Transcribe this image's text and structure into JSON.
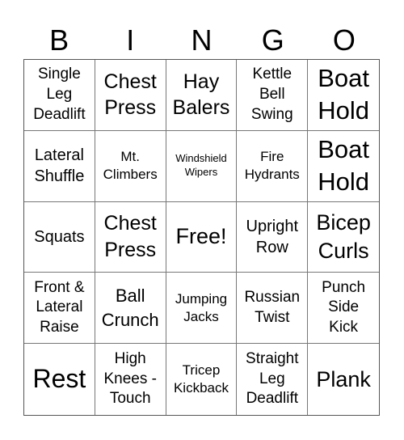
{
  "header": {
    "letters": [
      "B",
      "I",
      "N",
      "G",
      "O"
    ]
  },
  "cells": [
    [
      "Single",
      "Leg",
      "Deadlift"
    ],
    [
      "Chest",
      "Press"
    ],
    [
      "Hay",
      "Balers"
    ],
    [
      "Kettle",
      "Bell",
      "Swing"
    ],
    [
      "Boat",
      "Hold"
    ],
    [
      "Lateral",
      "Shuffle"
    ],
    [
      "Mt.",
      "Climbers"
    ],
    [
      "Windshield",
      "Wipers"
    ],
    [
      "Fire",
      "Hydrants"
    ],
    [
      "Boat",
      "Hold"
    ],
    [
      "Squats"
    ],
    [
      "Chest",
      "Press"
    ],
    [
      "Free!"
    ],
    [
      "Upright",
      "Row"
    ],
    [
      "Bicep",
      "Curls"
    ],
    [
      "Front &",
      "Lateral",
      "Raise"
    ],
    [
      "Ball",
      "Crunch"
    ],
    [
      "Jumping",
      "Jacks"
    ],
    [
      "Russian",
      "Twist"
    ],
    [
      "Punch",
      "Side",
      "Kick"
    ],
    [
      "Rest"
    ],
    [
      "High",
      "Knees -",
      "Touch"
    ],
    [
      "Tricep",
      "Kickback"
    ],
    [
      "Straight",
      "Leg",
      "Deadlift"
    ],
    [
      "Plank"
    ]
  ]
}
